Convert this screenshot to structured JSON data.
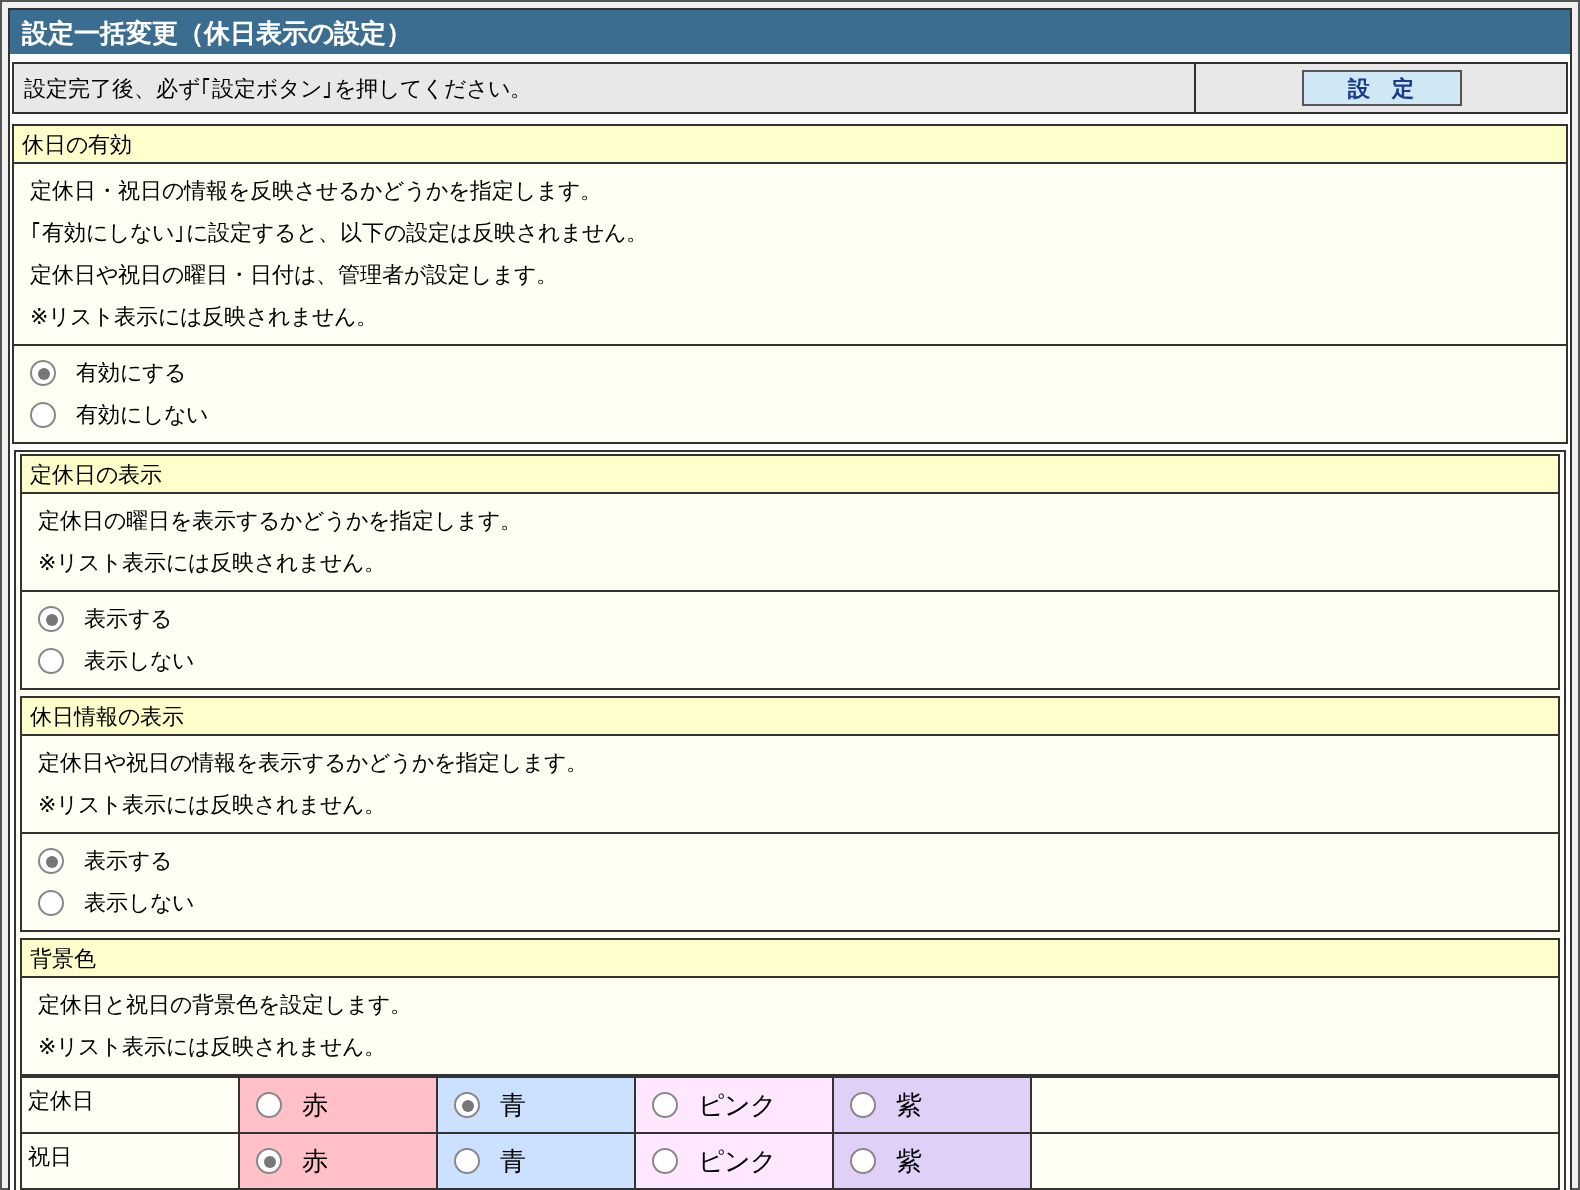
{
  "window": {
    "title": "設定一括変更（休日表示の設定）"
  },
  "notice": {
    "text": "設定完了後、必ず｢設定ボタン｣を押してください。",
    "button": "設　定"
  },
  "main_section": {
    "header": "休日の有効",
    "description": [
      "定休日・祝日の情報を反映させるかどうかを指定します。",
      "｢有効にしない｣に設定すると、以下の設定は反映されません。",
      "定休日や祝日の曜日・日付は、管理者が設定します。",
      "※リスト表示には反映されません。"
    ],
    "options": [
      {
        "label": "有効にする",
        "selected": true
      },
      {
        "label": "有効にしない",
        "selected": false
      }
    ]
  },
  "sub_sections": [
    {
      "kind": "radios",
      "header": "定休日の表示",
      "description": [
        "定休日の曜日を表示するかどうかを指定します。",
        "※リスト表示には反映されません。"
      ],
      "options": [
        {
          "label": "表示する",
          "selected": true
        },
        {
          "label": "表示しない",
          "selected": false
        }
      ]
    },
    {
      "kind": "radios",
      "header": "休日情報の表示",
      "description": [
        "定休日や祝日の情報を表示するかどうかを指定します。",
        "※リスト表示には反映されません。"
      ],
      "options": [
        {
          "label": "表示する",
          "selected": true
        },
        {
          "label": "表示しない",
          "selected": false
        }
      ]
    },
    {
      "kind": "colors",
      "header": "背景色",
      "description": [
        "定休日と祝日の背景色を設定します。",
        "※リスト表示には反映されません。"
      ],
      "rows": [
        {
          "label": "定休日",
          "options": [
            {
              "label": "赤",
              "color": "#ffc0c8",
              "selected": false
            },
            {
              "label": "青",
              "color": "#cce0ff",
              "selected": true
            },
            {
              "label": "ピンク",
              "color": "#ffe8ff",
              "selected": false
            },
            {
              "label": "紫",
              "color": "#e0d0f8",
              "selected": false
            }
          ]
        },
        {
          "label": "祝日",
          "options": [
            {
              "label": "赤",
              "color": "#ffc0c8",
              "selected": true
            },
            {
              "label": "青",
              "color": "#cce0ff",
              "selected": false
            },
            {
              "label": "ピンク",
              "color": "#ffe8ff",
              "selected": false
            },
            {
              "label": "紫",
              "color": "#e0d0f8",
              "selected": false
            }
          ]
        }
      ]
    }
  ]
}
